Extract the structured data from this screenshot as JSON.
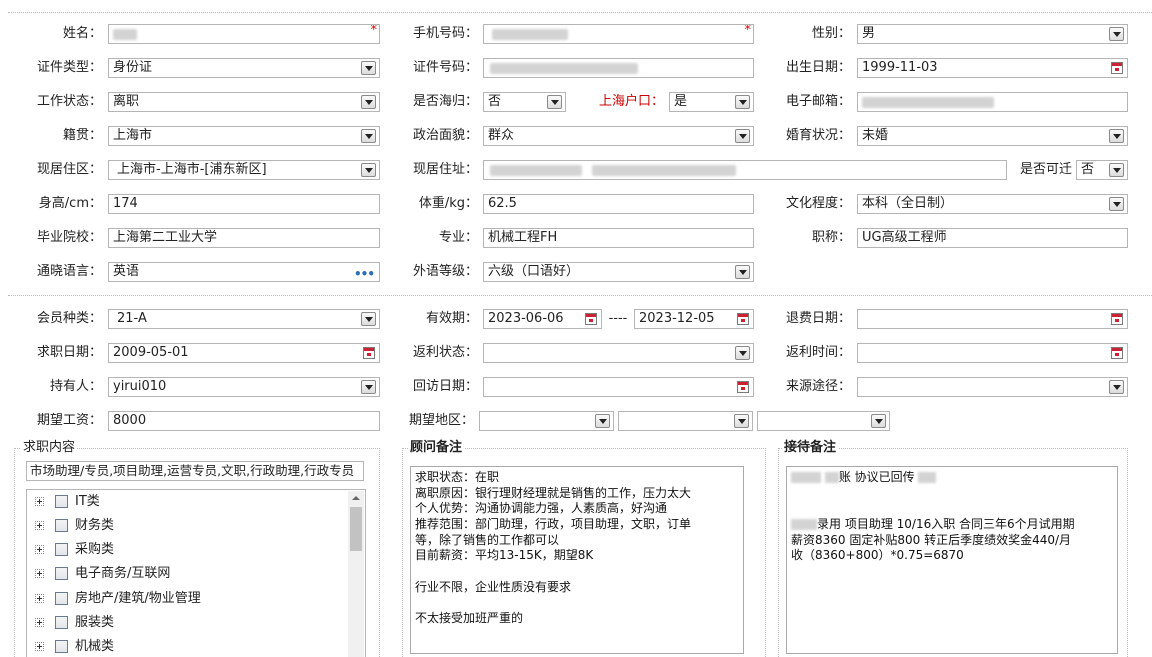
{
  "personal": {
    "name_label": "姓名：",
    "phone_label": "手机号码：",
    "gender_label": "性别：",
    "gender_value": "男",
    "idtype_label": "证件类型：",
    "idtype_value": "身份证",
    "idno_label": "证件号码：",
    "birth_label": "出生日期：",
    "birth_value": "1999-11-03",
    "workstatus_label": "工作状态：",
    "workstatus_value": "离职",
    "returnee_label": "是否海归：",
    "returnee_value": "否",
    "shhukou_label": "上海户口：",
    "shhukou_value": "是",
    "email_label": "电子邮箱：",
    "native_label": "籍贯：",
    "native_value": "上海市",
    "political_label": "政治面貌：",
    "political_value": "群众",
    "marital_label": "婚育状况：",
    "marital_value": "未婚",
    "residence_area_label": "现居住区：",
    "residence_area_value": "上海市-上海市-[浦东新区]",
    "address_label": "现居住址：",
    "relocate_label": "是否可迁",
    "relocate_value": "否",
    "height_label": "身高/cm：",
    "height_value": "174",
    "weight_label": "体重/kg：",
    "weight_value": "62.5",
    "education_label": "文化程度：",
    "education_value": "本科（全日制）",
    "school_label": "毕业院校：",
    "school_value": "上海第二工业大学",
    "major_label": "专业：",
    "major_value": "机械工程FH",
    "title_label": "职称：",
    "title_value": "UG高级工程师",
    "language_label": "通晓语言：",
    "language_value": "英语",
    "fl_level_label": "外语等级：",
    "fl_level_value": "六级（口语好）"
  },
  "membership": {
    "type_label": "会员种类：",
    "type_value": "21-A",
    "valid_label": "有效期：",
    "valid_from": "2023-06-06",
    "valid_sep": "----",
    "valid_to": "2023-12-05",
    "refund_date_label": "退费日期：",
    "job_date_label": "求职日期：",
    "job_date_value": "2009-05-01",
    "rebate_status_label": "返利状态：",
    "rebate_time_label": "返利时间：",
    "holder_label": "持有人：",
    "holder_value": "yirui010",
    "revisit_label": "回访日期：",
    "source_label": "来源途径：",
    "salary_label": "期望工资：",
    "salary_value": "8000",
    "region_label": "期望地区："
  },
  "job_content": {
    "title": "求职内容",
    "summary": "市场助理/专员,项目助理,运营专员,文职,行政助理,行政专员",
    "tree": [
      "IT类",
      "财务类",
      "采购类",
      "电子商务/互联网",
      "房地产/建筑/物业管理",
      "服装类",
      "机械类"
    ]
  },
  "advisor_notes": {
    "title": "顾问备注",
    "lines": [
      "求职状态：在职",
      "离职原因：银行理财经理就是销售的工作，压力太大",
      "个人优势：沟通协调能力强，人素质高，好沟通",
      "推荐范围：部门助理，行政，项目助理，文职，订单",
      "等，除了销售的工作都可以",
      "目前薪资：平均13-15K，期望8K",
      "",
      "行业不限，企业性质没有要求",
      "",
      "不太接受加班严重的"
    ]
  },
  "reception_notes": {
    "title": "接待备注",
    "line1": "账 协议已回传",
    "line2": "",
    "line3": "",
    "line4": "录用 项目助理 10/16入职  合同三年6个月试用期",
    "line5": "薪资8360 固定补贴800  转正后季度绩效奖金440/月",
    "line6": "收（8360+800）*0.75=6870"
  }
}
